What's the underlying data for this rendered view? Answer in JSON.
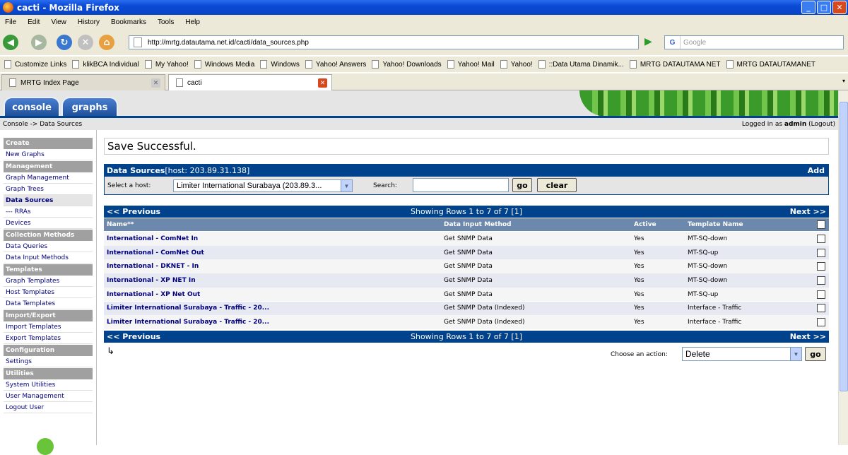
{
  "window": {
    "title": "cacti - Mozilla Firefox"
  },
  "menu": [
    "File",
    "Edit",
    "View",
    "History",
    "Bookmarks",
    "Tools",
    "Help"
  ],
  "url": "http://mrtg.datautama.net.id/cacti/data_sources.php",
  "search_placeholder": "Google",
  "bookmarks": [
    "Customize Links",
    "klikBCA Individual",
    "My Yahoo!",
    "Windows Media",
    "Windows",
    "Yahoo! Answers",
    "Yahoo! Downloads",
    "Yahoo! Mail",
    "Yahoo!",
    "::Data Utama Dinamik...",
    "MRTG DATAUTAMA NET",
    "MRTG DATAUTAMANET"
  ],
  "tabs": [
    {
      "label": "MRTG Index Page"
    },
    {
      "label": "cacti"
    }
  ],
  "cacti_tabs": {
    "console": "console",
    "graphs": "graphs"
  },
  "breadcrumb": "Console -> Data Sources",
  "login": {
    "prefix": "Logged in as ",
    "user": "admin",
    "logout": "(Logout)"
  },
  "sidebar": [
    {
      "type": "h",
      "label": "Create"
    },
    {
      "type": "i",
      "label": "New Graphs"
    },
    {
      "type": "h",
      "label": "Management"
    },
    {
      "type": "i",
      "label": "Graph Management"
    },
    {
      "type": "i",
      "label": "Graph Trees"
    },
    {
      "type": "i",
      "label": "Data Sources",
      "selected": true
    },
    {
      "type": "i",
      "label": "--- RRAs"
    },
    {
      "type": "i",
      "label": "Devices"
    },
    {
      "type": "h",
      "label": "Collection Methods"
    },
    {
      "type": "i",
      "label": "Data Queries"
    },
    {
      "type": "i",
      "label": "Data Input Methods"
    },
    {
      "type": "h",
      "label": "Templates"
    },
    {
      "type": "i",
      "label": "Graph Templates"
    },
    {
      "type": "i",
      "label": "Host Templates"
    },
    {
      "type": "i",
      "label": "Data Templates"
    },
    {
      "type": "h",
      "label": "Import/Export"
    },
    {
      "type": "i",
      "label": "Import Templates"
    },
    {
      "type": "i",
      "label": "Export Templates"
    },
    {
      "type": "h",
      "label": "Configuration"
    },
    {
      "type": "i",
      "label": "Settings"
    },
    {
      "type": "h",
      "label": "Utilities"
    },
    {
      "type": "i",
      "label": "System Utilities"
    },
    {
      "type": "i",
      "label": "User Management"
    },
    {
      "type": "i",
      "label": "Logout User"
    }
  ],
  "message": "Save Successful.",
  "ds_header": {
    "title": "Data Sources",
    "host": " [host: 203.89.31.138]",
    "add": "Add"
  },
  "filter": {
    "host_label": "Select a host:",
    "host_value": "Limiter International Surabaya (203.89.3...",
    "search_label": "Search:",
    "go": "go",
    "clear": "clear"
  },
  "pager": {
    "prev": "<< Previous",
    "status": "Showing Rows 1 to 7 of 7 [1]",
    "next": "Next >>"
  },
  "columns": [
    "Name**",
    "Data Input Method",
    "Active",
    "Template Name"
  ],
  "rows": [
    [
      "International - ComNet In",
      "Get SNMP Data",
      "Yes",
      "MT-SQ-down"
    ],
    [
      "International - ComNet Out",
      "Get SNMP Data",
      "Yes",
      "MT-SQ-up"
    ],
    [
      "International - DKNET - In",
      "Get SNMP Data",
      "Yes",
      "MT-SQ-down"
    ],
    [
      "International - XP NET In",
      "Get SNMP Data",
      "Yes",
      "MT-SQ-down"
    ],
    [
      "International - XP Net Out",
      "Get SNMP Data",
      "Yes",
      "MT-SQ-up"
    ],
    [
      "Limiter International Surabaya - Traffic - 20...",
      "Get SNMP Data (Indexed)",
      "Yes",
      "Interface - Traffic"
    ],
    [
      "Limiter International Surabaya - Traffic - 20...",
      "Get SNMP Data (Indexed)",
      "Yes",
      "Interface - Traffic"
    ]
  ],
  "action": {
    "label": "Choose an action:",
    "value": "Delete",
    "go": "go"
  }
}
